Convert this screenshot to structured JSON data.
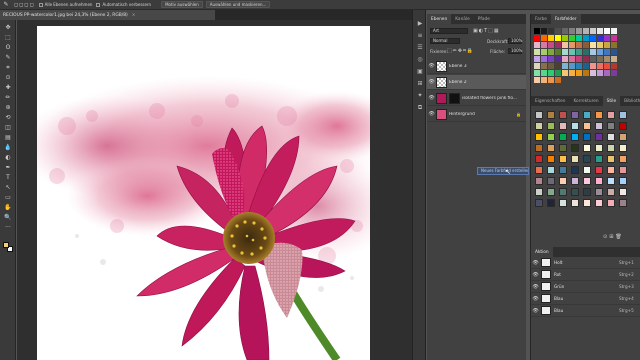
{
  "options_bar": {
    "buttons": [
      {
        "label": "Alle Ebenen aufnehmen",
        "kind": "check"
      },
      {
        "label": "Automatisch verbessern",
        "kind": "check"
      },
      {
        "label": "Motiv auswählen",
        "kind": "button"
      },
      {
        "label": "Auswählen und maskieren...",
        "kind": "button"
      }
    ]
  },
  "document": {
    "tab_title": "RECIOUS PP-watercolor1.jpg bei 24,3% (Ebene 2, RGB/8)",
    "close_glyph": "×"
  },
  "layers_panel": {
    "tabs": [
      "Ebenen",
      "Kanäle",
      "Pfade"
    ],
    "filter_label": "Art",
    "blend_mode": "Normal",
    "opacity_label": "Deckkraft:",
    "opacity_value": "100%",
    "lock_label": "Fixieren:",
    "fill_label": "Fläche:",
    "fill_value": "100%",
    "layers": [
      {
        "name": "Ebene 3",
        "selected": false,
        "thumb": "checker"
      },
      {
        "name": "Ebene 2",
        "selected": true,
        "thumb": "checker"
      },
      {
        "name": "isolated flowers pink flo...",
        "selected": false,
        "thumb": "flower-mask"
      },
      {
        "name": "Hintergrund",
        "selected": false,
        "thumb": "flower"
      }
    ]
  },
  "swatches_panel": {
    "tabs": [
      "Farbe",
      "Farbfelder"
    ],
    "colors": [
      "#000000",
      "#1a1a1a",
      "#333333",
      "#4d4d4d",
      "#666666",
      "#808080",
      "#999999",
      "#b3b3b3",
      "#cccccc",
      "#e6e6e6",
      "#ffffff",
      "#f2f2f2",
      "#ff0000",
      "#ff6600",
      "#ffcc00",
      "#ffff00",
      "#99cc00",
      "#33cc33",
      "#00cc99",
      "#0099cc",
      "#0066ff",
      "#3333cc",
      "#9933cc",
      "#cc3399",
      "#e8b4c8",
      "#d97aa6",
      "#c24d86",
      "#9c2f66",
      "#f4c2a1",
      "#e59866",
      "#c0724a",
      "#8d5b3a",
      "#f7e0a3",
      "#e8c96a",
      "#c9a441",
      "#8b7329",
      "#cfe3a6",
      "#a8cc6a",
      "#7fa83f",
      "#597a2b",
      "#a6d9cf",
      "#6ac2b0",
      "#3f9c8a",
      "#2b7063",
      "#a6c8e8",
      "#6a9fd9",
      "#3f77c2",
      "#2b5590",
      "#c4a6e8",
      "#9c6ad9",
      "#7a3fc2",
      "#582b90",
      "#e8a6c4",
      "#d96a9c",
      "#c23f77",
      "#902b55",
      "#5c5c5c",
      "#7a6a5a",
      "#a38b6d",
      "#c9b18f",
      "#e0d4bd",
      "#8a6f4e",
      "#6d5a43",
      "#4e4030",
      "#7fb3d5",
      "#5499c7",
      "#2980b9",
      "#1f618d",
      "#f1948a",
      "#ec7063",
      "#e74c3c",
      "#b03a2e",
      "#82e0aa",
      "#58d68d",
      "#2ecc71",
      "#239b56",
      "#f8c471",
      "#f5b041",
      "#f39c12",
      "#b9770e",
      "#d7bde2",
      "#c39bd3",
      "#a569bd",
      "#7d3c98",
      "#f5cba7",
      "#f0b27a",
      "#eb984e",
      "#ca6f1e"
    ]
  },
  "styles_panel": {
    "tabs": [
      "Eigenschaften",
      "Korrekturen",
      "Stile",
      "Bibliotheken"
    ],
    "colors": [
      "#c7c7c7",
      "#b08040",
      "#c0504d",
      "#8064a2",
      "#4bacc6",
      "#f79646",
      "#e0a0a0",
      "#a0c0e0",
      "#d0d0a0",
      "#9bbb59",
      "#e6b8b7",
      "#b7dee8",
      "#fac090",
      "#ccc0da",
      "#808080",
      "#c00000",
      "#ffc000",
      "#92d050",
      "#00b050",
      "#00b0f0",
      "#0070c0",
      "#7030a0",
      "#e0e0e0",
      "#d4a373",
      "#bc6c25",
      "#dda15e",
      "#606c38",
      "#283618",
      "#fefae0",
      "#e9edc9",
      "#ccd5ae",
      "#faedcd",
      "#d62828",
      "#f77f00",
      "#fcbf49",
      "#eae2b7",
      "#264653",
      "#2a9d8f",
      "#e9c46a",
      "#f4a261",
      "#e76f51",
      "#a8dadc",
      "#457b9d",
      "#1d3557",
      "#f1faee",
      "#e63946",
      "#ffb4a2",
      "#e5989b",
      "#b5838d",
      "#6d6875",
      "#ffcdb2",
      "#cdb4db",
      "#ffc8dd",
      "#ffafcc",
      "#bde0fe",
      "#a2d2ff",
      "#cad2c5",
      "#84a98c",
      "#52796f",
      "#354f52",
      "#2f3e46",
      "#9a8c98",
      "#c9ada7",
      "#f2e9e4",
      "#4a4e69",
      "#22223b",
      "#d8e2dc",
      "#ece4db",
      "#ffe5d9",
      "#ffcad4",
      "#f4acb7",
      "#9d8189"
    ]
  },
  "history_panel": {
    "title": "Aktion",
    "items": [
      {
        "name": "Holt",
        "key": "Strg+1"
      },
      {
        "name": "Rot",
        "key": "Strg+2"
      },
      {
        "name": "Grün",
        "key": "Strg+3"
      },
      {
        "name": "Blau",
        "key": "Strg+4"
      },
      {
        "name": "Blau",
        "key": "Strg+5"
      }
    ]
  },
  "tooltip": {
    "text": "Neues Farbfeld erstellen"
  },
  "toolbar": {
    "tools": [
      "move-tool",
      "marquee-tool",
      "lasso-tool",
      "quick-select-tool",
      "crop-tool",
      "eyedropper-tool",
      "healing-tool",
      "brush-tool",
      "clone-tool",
      "history-brush-tool",
      "eraser-tool",
      "gradient-tool",
      "blur-tool",
      "dodge-tool",
      "pen-tool",
      "type-tool",
      "path-select-tool",
      "shape-tool",
      "hand-tool",
      "zoom-tool"
    ],
    "glyphs": [
      "✥",
      "⬚",
      "ʘ",
      "✎",
      "⌗",
      "⊙",
      "✚",
      "✏",
      "⊛",
      "⟲",
      "◫",
      "▤",
      "💧",
      "◐",
      "✒",
      "T",
      "↖",
      "▭",
      "✋",
      "🔍"
    ],
    "more_glyph": "···",
    "foreground_color": "#f2d16b",
    "background_color": "#ffffff"
  },
  "panel_strip": {
    "glyphs": [
      "▶",
      "≡",
      "☰",
      "◎",
      "▣",
      "⊞",
      "✦",
      "⧉"
    ]
  },
  "icons": {
    "eye": "👁",
    "lock": "🔒",
    "cursor": "↖"
  }
}
